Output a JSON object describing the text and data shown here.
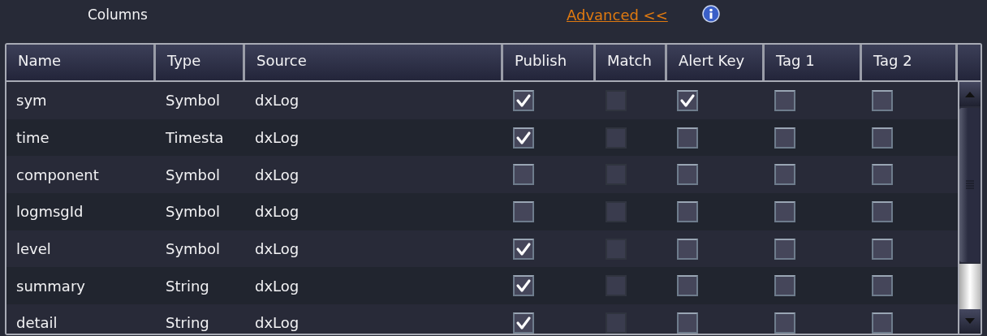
{
  "section_title": "Columns",
  "advanced_link": "Advanced <<",
  "table": {
    "columns": [
      {
        "label": "Name",
        "kind": "text"
      },
      {
        "label": "Type",
        "kind": "text"
      },
      {
        "label": "Source",
        "kind": "text"
      },
      {
        "label": "Publish",
        "kind": "check",
        "disabled": false
      },
      {
        "label": "Match",
        "kind": "check",
        "disabled": true
      },
      {
        "label": "Alert Key",
        "kind": "check",
        "disabled": false
      },
      {
        "label": "Tag 1",
        "kind": "check",
        "disabled": false
      },
      {
        "label": "Tag 2",
        "kind": "check",
        "disabled": false
      }
    ],
    "rows": [
      {
        "cells": [
          "sym",
          "Symbol",
          "dxLog"
        ],
        "checks": [
          true,
          false,
          true,
          false,
          false
        ]
      },
      {
        "cells": [
          "time",
          "Timesta",
          "dxLog"
        ],
        "checks": [
          true,
          false,
          false,
          false,
          false
        ]
      },
      {
        "cells": [
          "component",
          "Symbol",
          "dxLog"
        ],
        "checks": [
          false,
          false,
          false,
          false,
          false
        ]
      },
      {
        "cells": [
          "logmsgId",
          "Symbol",
          "dxLog"
        ],
        "checks": [
          false,
          false,
          false,
          false,
          false
        ]
      },
      {
        "cells": [
          "level",
          "Symbol",
          "dxLog"
        ],
        "checks": [
          true,
          false,
          false,
          false,
          false
        ]
      },
      {
        "cells": [
          "summary",
          "String",
          "dxLog"
        ],
        "checks": [
          true,
          false,
          false,
          false,
          false
        ]
      },
      {
        "cells": [
          "detail",
          "String",
          "dxLog"
        ],
        "checks": [
          true,
          false,
          false,
          false,
          false
        ]
      }
    ]
  }
}
